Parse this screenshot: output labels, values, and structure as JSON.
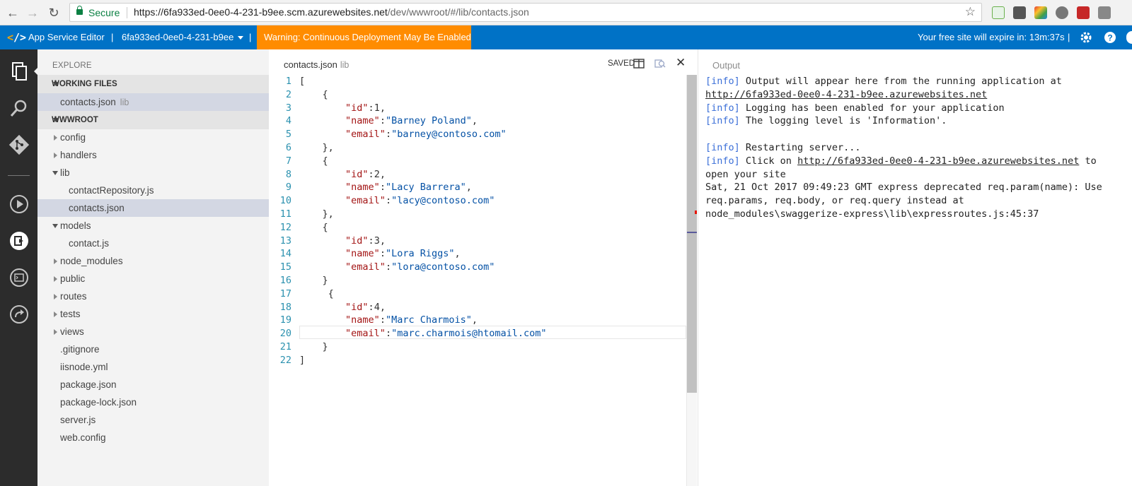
{
  "browser": {
    "secure_label": "Secure",
    "url_scheme_host": "https://6fa933ed-0ee0-4-231-b9ee.scm.azurewebsites.net",
    "url_path": "/dev/wwwroot/#/lib/contacts.json",
    "icons": [
      "back-icon",
      "forward-icon",
      "reload-icon",
      "star-icon"
    ]
  },
  "appbar": {
    "title": "App Service Editor",
    "site_name": "6fa933ed-0ee0-4-231-b9ee",
    "warning": "Warning: Continuous Deployment May Be Enabled",
    "expire_text": "Your free site will expire in: 13m:37s",
    "accent_color": "#0072c6",
    "warning_color": "#ff8c00"
  },
  "sidebar": {
    "title": "EXPLORE",
    "working_files_label": "WORKING FILES",
    "working_file": {
      "name": "contacts.json",
      "folder": "lib"
    },
    "root_label": "WWWROOT",
    "tree": [
      {
        "name": "config",
        "type": "folder",
        "expanded": false
      },
      {
        "name": "handlers",
        "type": "folder",
        "expanded": false
      },
      {
        "name": "lib",
        "type": "folder",
        "expanded": true
      },
      {
        "name": "contactRepository.js",
        "type": "file",
        "child": true
      },
      {
        "name": "contacts.json",
        "type": "file",
        "child": true,
        "selected": true
      },
      {
        "name": "models",
        "type": "folder",
        "expanded": true
      },
      {
        "name": "contact.js",
        "type": "file",
        "child": true
      },
      {
        "name": "node_modules",
        "type": "folder",
        "expanded": false
      },
      {
        "name": "public",
        "type": "folder",
        "expanded": false
      },
      {
        "name": "routes",
        "type": "folder",
        "expanded": false
      },
      {
        "name": "tests",
        "type": "folder",
        "expanded": false
      },
      {
        "name": "views",
        "type": "folder",
        "expanded": false
      },
      {
        "name": ".gitignore",
        "type": "file"
      },
      {
        "name": "iisnode.yml",
        "type": "file"
      },
      {
        "name": "package.json",
        "type": "file"
      },
      {
        "name": "package-lock.json",
        "type": "file"
      },
      {
        "name": "server.js",
        "type": "file"
      },
      {
        "name": "web.config",
        "type": "file"
      }
    ]
  },
  "editor": {
    "file_name": "contacts.json",
    "folder": "lib",
    "status": "SAVED",
    "lines": [
      "1",
      "2",
      "3",
      "4",
      "5",
      "6",
      "7",
      "8",
      "9",
      "10",
      "11",
      "12",
      "13",
      "14",
      "15",
      "16",
      "17",
      "18",
      "19",
      "20",
      "21",
      "22"
    ],
    "contacts": [
      {
        "id": "1",
        "name": "Barney Poland",
        "email": "barney@contoso.com"
      },
      {
        "id": "2",
        "name": "Lacy Barrera",
        "email": "lacy@contoso.com"
      },
      {
        "id": "3",
        "name": "Lora Riggs",
        "email": "lora@contoso.com"
      },
      {
        "id": "4",
        "name": "Marc Charmois",
        "email": "marc.charmois@htomail.com"
      }
    ]
  },
  "output": {
    "title": "Output",
    "tag": "[info]",
    "l1": " Output will appear here from the running application at",
    "l1_link": "http://6fa933ed-0ee0-4-231-b9ee.azurewebsites.net",
    "l2": " Logging has been enabled for your application",
    "l3": " The logging level is 'Information'.",
    "l4": " Restarting server...",
    "l5_pre": " Click on ",
    "l5_link": "http://6fa933ed-0ee0-4-231-b9ee.azurewebsites.net",
    "l5_post": " to",
    "l6": "open your site",
    "l7": "Sat, 21 Oct 2017 09:49:23 GMT express deprecated req.param(name): Use",
    "l8": "req.params, req.body, or req.query instead at",
    "l9": "node_modules\\swaggerize-express\\lib\\expressroutes.js:45:37"
  }
}
